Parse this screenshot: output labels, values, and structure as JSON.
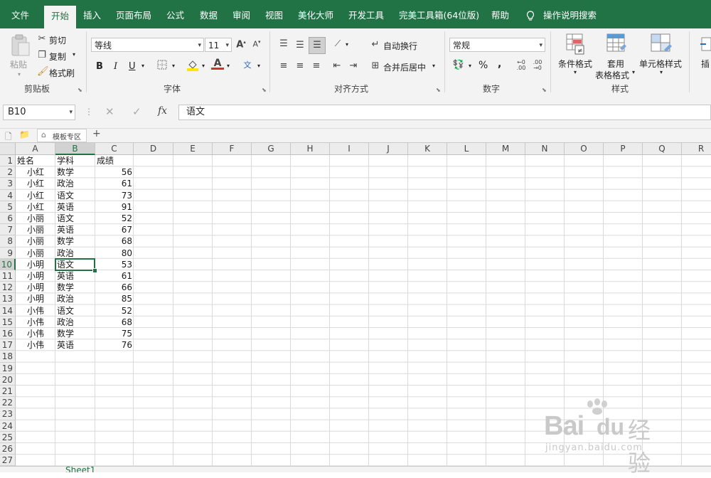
{
  "menu": {
    "tabs": [
      "文件",
      "开始",
      "插入",
      "页面布局",
      "公式",
      "数据",
      "审阅",
      "视图",
      "美化大师",
      "开发工具",
      "完美工具箱(64位版)",
      "帮助"
    ],
    "active": "开始",
    "tell_me": "操作说明搜索"
  },
  "ribbon": {
    "clipboard": {
      "paste": "粘贴",
      "cut": "剪切",
      "copy": "复制",
      "format_painter": "格式刷",
      "group": "剪贴板"
    },
    "font": {
      "name": "等线",
      "size": "11",
      "bold": "B",
      "italic": "I",
      "underline": "U",
      "group": "字体",
      "font_color": "#d32f2f",
      "fill_color": "#ffe600"
    },
    "alignment": {
      "wrap": "自动换行",
      "merge": "合并后居中",
      "group": "对齐方式"
    },
    "number": {
      "format": "常规",
      "percent": "%",
      "comma": ",",
      "group": "数字"
    },
    "styles": {
      "conditional": "条件格式",
      "table_line1": "套用",
      "table_line2": "表格格式",
      "cell_styles": "单元格样式",
      "group": "样式"
    },
    "insert": "插"
  },
  "formula_bar": {
    "name_box": "B10",
    "fx": "fx",
    "value": "语文"
  },
  "toolbar2": {
    "template_tab": "模板专区",
    "add": "+"
  },
  "sheet": {
    "columns": [
      "A",
      "B",
      "C",
      "D",
      "E",
      "F",
      "G",
      "H",
      "I",
      "J",
      "K",
      "L",
      "M",
      "N",
      "O",
      "P",
      "Q",
      "R"
    ],
    "selected_col": "B",
    "selected_row": 10,
    "row_numbers": [
      1,
      2,
      3,
      4,
      5,
      6,
      7,
      8,
      9,
      10,
      11,
      12,
      13,
      14,
      15,
      16,
      17,
      18,
      19,
      20,
      21,
      22,
      23,
      24,
      25,
      26,
      27
    ],
    "headers": [
      "姓名",
      "学科",
      "成绩"
    ],
    "rows": [
      [
        "小红",
        "数学",
        "56"
      ],
      [
        "小红",
        "政治",
        "61"
      ],
      [
        "小红",
        "语文",
        "73"
      ],
      [
        "小红",
        "英语",
        "91"
      ],
      [
        "小丽",
        "语文",
        "52"
      ],
      [
        "小丽",
        "英语",
        "67"
      ],
      [
        "小丽",
        "数学",
        "68"
      ],
      [
        "小丽",
        "政治",
        "80"
      ],
      [
        "小明",
        "语文",
        "53"
      ],
      [
        "小明",
        "英语",
        "61"
      ],
      [
        "小明",
        "数学",
        "66"
      ],
      [
        "小明",
        "政治",
        "85"
      ],
      [
        "小伟",
        "语文",
        "52"
      ],
      [
        "小伟",
        "政治",
        "68"
      ],
      [
        "小伟",
        "数学",
        "75"
      ],
      [
        "小伟",
        "英语",
        "76"
      ]
    ]
  },
  "sheet_tab": "Sheet1",
  "watermark": {
    "brand": "Bai",
    "du": "du",
    "cn": "经验",
    "url": "jingyan.baidu.com"
  },
  "colors": {
    "accent": "#217346"
  }
}
